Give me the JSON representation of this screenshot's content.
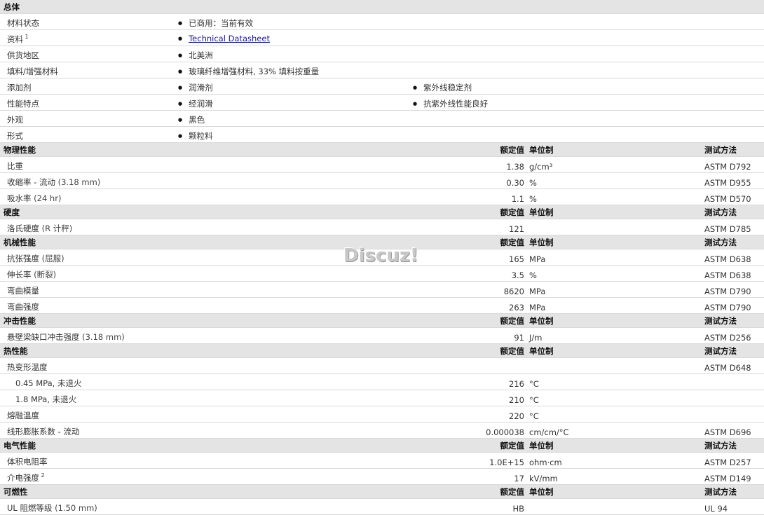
{
  "overall": {
    "title": "总体",
    "rows": [
      {
        "label": "材料状态",
        "items": [
          "已商用：当前有效"
        ]
      },
      {
        "label": "资料",
        "sup": "1",
        "items": [
          "Technical Datasheet"
        ],
        "link": true
      },
      {
        "label": "供货地区",
        "items": [
          "北美洲"
        ]
      },
      {
        "label": "填料/增强材料",
        "items": [
          "玻璃纤维增强材料, 33% 填料按重量"
        ]
      },
      {
        "label": "添加剂",
        "items": [
          "润滑剂",
          "紫外线稳定剂"
        ]
      },
      {
        "label": "性能特点",
        "items": [
          "经润滑",
          "抗紫外线性能良好"
        ]
      },
      {
        "label": "外观",
        "items": [
          "黑色"
        ]
      },
      {
        "label": "形式",
        "items": [
          "颗粒料"
        ]
      }
    ]
  },
  "col_headers": {
    "value": "额定值",
    "unit": "单位制",
    "test": "测试方法"
  },
  "sections": [
    {
      "title": "物理性能",
      "rows": [
        {
          "label": "比重",
          "value": "1.38",
          "unit": "g/cm³",
          "test": "ASTM D792"
        },
        {
          "label": "收缩率 - 流动",
          "paren": "(3.18 mm)",
          "value": "0.30",
          "unit": "%",
          "test": "ASTM D955"
        },
        {
          "label": "吸水率",
          "paren": "(24 hr)",
          "value": "1.1",
          "unit": "%",
          "test": "ASTM D570"
        }
      ]
    },
    {
      "title": "硬度",
      "rows": [
        {
          "label": "洛氏硬度",
          "paren": "(R 计秤)",
          "value": "121",
          "unit": "",
          "test": "ASTM D785"
        }
      ]
    },
    {
      "title": "机械性能",
      "rows": [
        {
          "label": "抗张强度",
          "paren": "(屈服)",
          "value": "165",
          "unit": "MPa",
          "test": "ASTM D638"
        },
        {
          "label": "伸长率",
          "paren": "(断裂)",
          "value": "3.5",
          "unit": "%",
          "test": "ASTM D638"
        },
        {
          "label": "弯曲模量",
          "value": "8620",
          "unit": "MPa",
          "test": "ASTM D790"
        },
        {
          "label": "弯曲强度",
          "value": "263",
          "unit": "MPa",
          "test": "ASTM D790"
        }
      ]
    },
    {
      "title": "冲击性能",
      "rows": [
        {
          "label": "悬壁梁缺口冲击强度",
          "paren": "(3.18 mm)",
          "value": "91",
          "unit": "J/m",
          "test": "ASTM D256"
        }
      ]
    },
    {
      "title": "热性能",
      "rows": [
        {
          "label": "热变形温度",
          "value": "",
          "unit": "",
          "test": "ASTM D648"
        },
        {
          "label": "0.45 MPa, 未退火",
          "indent": true,
          "value": "216",
          "unit": "°C",
          "test": ""
        },
        {
          "label": "1.8 MPa, 未退火",
          "indent": true,
          "value": "210",
          "unit": "°C",
          "test": ""
        },
        {
          "label": "熔融温度",
          "value": "220",
          "unit": "°C",
          "test": ""
        },
        {
          "label": "线形膨胀系数 - 流动",
          "value": "0.000038",
          "unit": "cm/cm/°C",
          "test": "ASTM D696"
        }
      ]
    },
    {
      "title": "电气性能",
      "rows": [
        {
          "label": "体积电阻率",
          "value": "1.0E+15",
          "unit": "ohm·cm",
          "test": "ASTM D257"
        },
        {
          "label": "介电强度",
          "sup": "2",
          "value": "17",
          "unit": "kV/mm",
          "test": "ASTM D149"
        }
      ]
    },
    {
      "title": "可燃性",
      "rows": [
        {
          "label": "UL 阻燃等级",
          "paren": "(1.50 mm)",
          "value": "HB",
          "unit": "",
          "test": "UL 94"
        }
      ]
    }
  ],
  "watermark": "Discuz!"
}
